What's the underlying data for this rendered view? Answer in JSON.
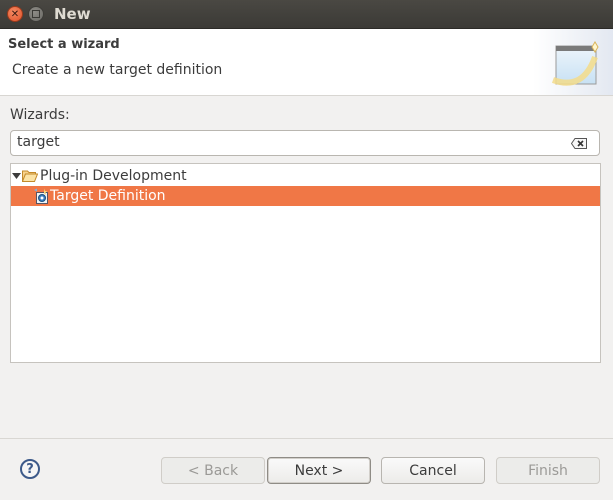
{
  "window": {
    "title": "New",
    "close_icon": "close-icon",
    "maximize_icon": "maximize-icon"
  },
  "header": {
    "title": "Select a wizard",
    "description": "Create a new target definition",
    "banner_icon": "new-wizard-banner-icon"
  },
  "wizards": {
    "label": "Wizards:",
    "filter_value": "target",
    "clear_icon": "clear-filter-icon"
  },
  "tree": {
    "items": [
      {
        "label": "Plug-in Development",
        "icon": "folder-open-icon",
        "expanded": true,
        "selected": false
      },
      {
        "label": "Target Definition",
        "icon": "target-definition-icon",
        "selected": true
      }
    ]
  },
  "colors": {
    "selection": "#f07746",
    "titlebar": "#3f3e3a",
    "close_button": "#e95b2f"
  },
  "footer": {
    "help_label": "?",
    "back_label": "< Back",
    "next_label": "Next >",
    "cancel_label": "Cancel",
    "finish_label": "Finish"
  }
}
